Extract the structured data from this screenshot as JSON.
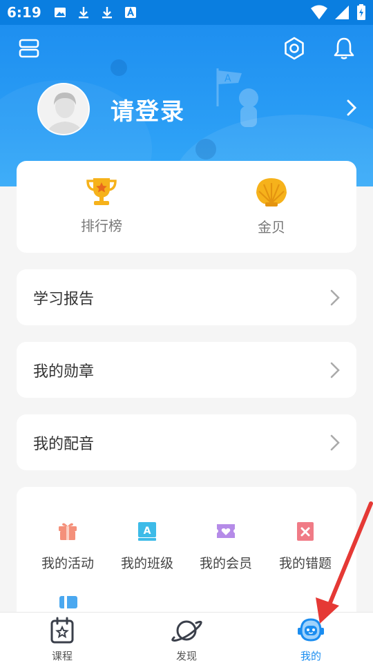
{
  "status_bar": {
    "time": "6:19"
  },
  "header": {
    "login_text": "请登录"
  },
  "stats": [
    {
      "label": "排行榜",
      "icon": "trophy-icon"
    },
    {
      "label": "金贝",
      "icon": "shell-icon"
    }
  ],
  "rows": [
    {
      "label": "学习报告"
    },
    {
      "label": "我的勋章"
    },
    {
      "label": "我的配音"
    }
  ],
  "grid": [
    {
      "label": "我的活动",
      "icon": "gift-icon",
      "color": "#f08a6c"
    },
    {
      "label": "我的班级",
      "icon": "class-icon",
      "color": "#3dbbe8"
    },
    {
      "label": "我的会员",
      "icon": "vip-icon",
      "color": "#b58be8"
    },
    {
      "label": "我的错题",
      "icon": "mistake-icon",
      "color": "#f07b86"
    }
  ],
  "tabs": [
    {
      "label": "课程",
      "icon": "calendar-icon"
    },
    {
      "label": "发现",
      "icon": "planet-icon"
    },
    {
      "label": "我的",
      "icon": "robot-icon",
      "active": true
    }
  ],
  "colors": {
    "primary": "#1a8df0",
    "arrow": "#e53935"
  }
}
